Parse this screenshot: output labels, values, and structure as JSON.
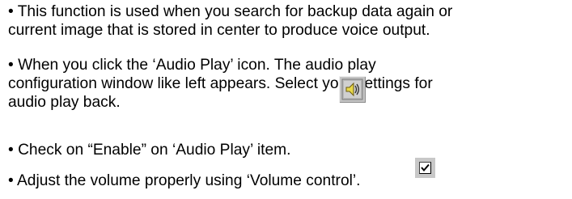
{
  "paragraphs": [
    {
      "bullet": "•",
      "lines": [
        "This function is used when you search for backup data again or",
        "current image that is stored in center to produce voice output."
      ]
    },
    {
      "bullet": "•",
      "lines": [
        "When you click the ‘Audio Play’ icon.          The audio play",
        "configuration window like left appears.  Select your settings for",
        "audio play back."
      ]
    },
    {
      "bullet": "•",
      "lines": [
        "Check on “Enable” on ‘Audio Play’ item."
      ]
    },
    {
      "bullet": "•",
      "lines": [
        "Adjust the volume properly using ‘Volume control’."
      ]
    }
  ],
  "icons": {
    "audio_play": "audio-play-icon",
    "checkbox": "checked-checkbox-icon"
  },
  "colors": {
    "text": "#000000",
    "icon_face": "#c4c4c4",
    "icon_accent": "#e8d84a"
  }
}
